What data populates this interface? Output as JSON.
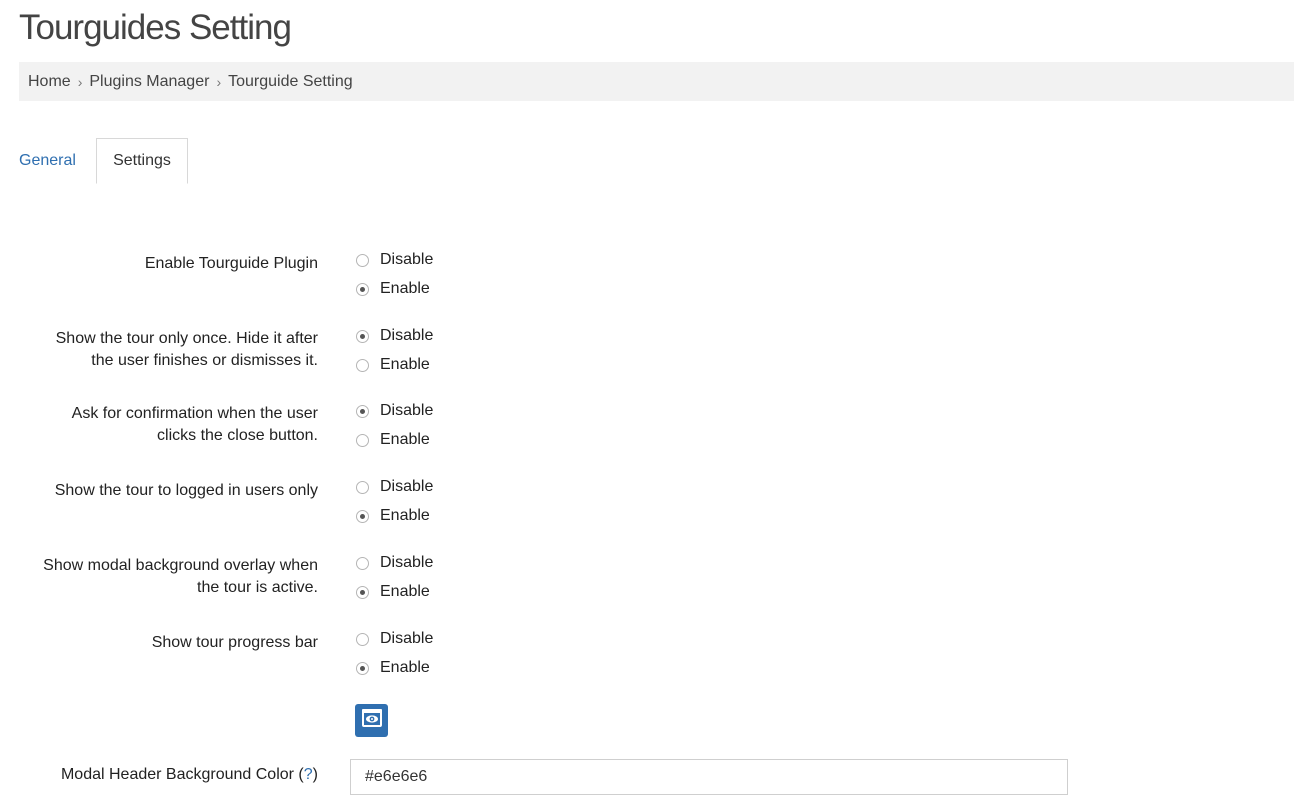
{
  "page": {
    "title": "Tourguides Setting"
  },
  "breadcrumb": {
    "items": [
      "Home",
      "Plugins Manager",
      "Tourguide Setting"
    ],
    "separator": "›"
  },
  "tabs": [
    {
      "label": "General",
      "active": false
    },
    {
      "label": "Settings",
      "active": true
    }
  ],
  "settings": [
    {
      "label_lines": [
        "Enable Tourguide Plugin"
      ],
      "options": [
        {
          "label": "Disable",
          "checked": false
        },
        {
          "label": "Enable",
          "checked": true
        }
      ]
    },
    {
      "label_lines": [
        "Show the tour only once. Hide it after",
        "the user finishes or dismisses it."
      ],
      "options": [
        {
          "label": "Disable",
          "checked": true
        },
        {
          "label": "Enable",
          "checked": false
        }
      ]
    },
    {
      "label_lines": [
        "Ask for confirmation when the user",
        "clicks the close button."
      ],
      "options": [
        {
          "label": "Disable",
          "checked": true
        },
        {
          "label": "Enable",
          "checked": false
        }
      ]
    },
    {
      "label_lines": [
        "Show the tour to logged in users only"
      ],
      "options": [
        {
          "label": "Disable",
          "checked": false
        },
        {
          "label": "Enable",
          "checked": true
        }
      ]
    },
    {
      "label_lines": [
        "Show modal background overlay when",
        "the tour is active."
      ],
      "options": [
        {
          "label": "Disable",
          "checked": false
        },
        {
          "label": "Enable",
          "checked": true
        }
      ]
    },
    {
      "label_lines": [
        "Show tour progress bar"
      ],
      "options": [
        {
          "label": "Disable",
          "checked": false
        },
        {
          "label": "Enable",
          "checked": true
        }
      ]
    }
  ],
  "preview_button": {
    "icon": "eye-icon"
  },
  "modal_header_color": {
    "label": "Modal Header Background Color (",
    "help_text": "?",
    "label_suffix": ")",
    "value": "#e6e6e6"
  },
  "colors": {
    "link": "#2f6fb0",
    "breadcrumb_bg": "#f2f2f2"
  }
}
